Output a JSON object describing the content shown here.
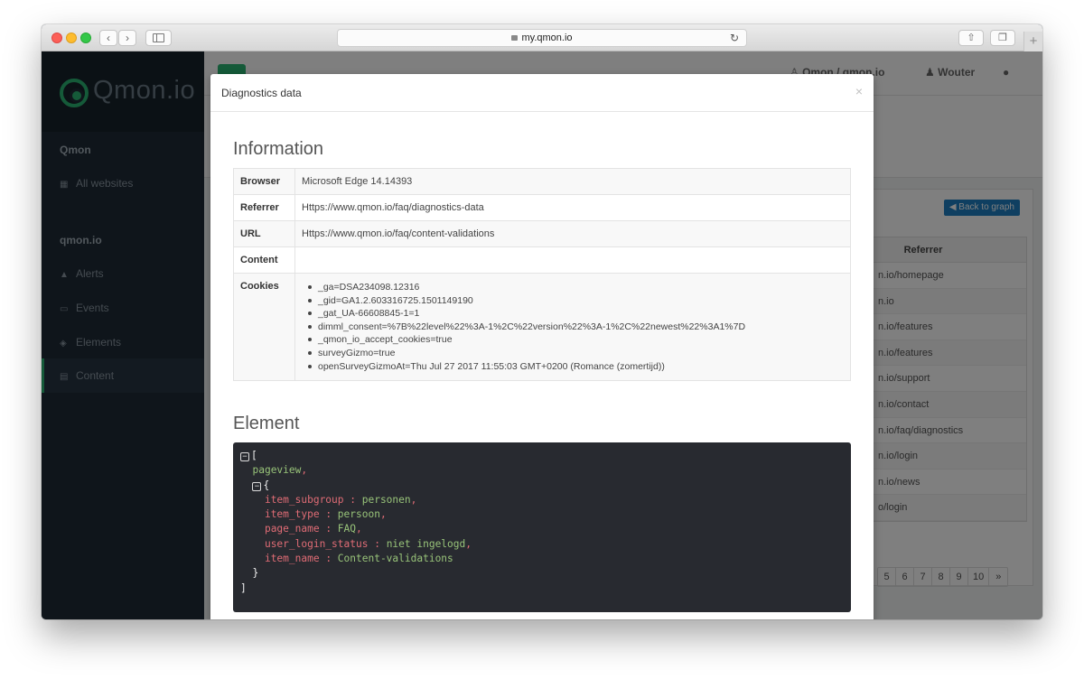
{
  "browser": {
    "url": "my.qmon.io"
  },
  "sidebar": {
    "logo_text": "Qmon.io",
    "section1": "Qmon",
    "item_all": "All websites",
    "section2": "qmon.io",
    "items": [
      {
        "label": "Alerts",
        "icon": "bell-icon"
      },
      {
        "label": "Events",
        "icon": "calendar-icon"
      },
      {
        "label": "Elements",
        "icon": "cube-icon"
      },
      {
        "label": "Content",
        "icon": "file-icon"
      }
    ]
  },
  "topbar": {
    "account": "Qmon / qmon.io",
    "user": "Wouter"
  },
  "panel": {
    "back_button": "Back to graph",
    "referrer_header": "Referrer",
    "referrer_rows": [
      "n.io/homepage",
      "n.io",
      "n.io/features",
      "n.io/features",
      "n.io/support",
      "n.io/contact",
      "n.io/faq/diagnostics",
      "n.io/login",
      "n.io/news",
      "o/login"
    ],
    "pager": [
      "5",
      "6",
      "7",
      "8",
      "9",
      "10",
      "»"
    ]
  },
  "modal": {
    "title": "Diagnostics data",
    "close": "×",
    "information_title": "Information",
    "info": {
      "browser_label": "Browser",
      "browser_value": "Microsoft Edge 14.14393",
      "referrer_label": "Referrer",
      "referrer_value": "Https://www.qmon.io/faq/diagnostics-data",
      "url_label": "URL",
      "url_value": "Https://www.qmon.io/faq/content-validations",
      "content_label": "Content",
      "content_value": "",
      "cookies_label": "Cookies",
      "cookies": [
        "_ga=DSA234098.12316",
        "_gid=GA1.2.603316725.1501149190",
        "_gat_UA-66608845-1=1",
        "dimml_consent=%7B%22level%22%3A-1%2C%22version%22%3A-1%2C%22newest%22%3A1%7D",
        "_qmon_io_accept_cookies=true",
        "surveyGizmo=true",
        "openSurveyGizmoAt=Thu Jul 27 2017 11:55:03 GMT+0200 (Romance (zomertijd))"
      ]
    },
    "element_title": "Element",
    "element": {
      "open_bracket": "[",
      "pageview": "pageview",
      "open_brace": "{",
      "fields": [
        {
          "key": "item_subgroup",
          "value": "personen"
        },
        {
          "key": "item_type",
          "value": "persoon"
        },
        {
          "key": "page_name",
          "value": "FAQ"
        },
        {
          "key": "user_login_status",
          "value": "niet ingelogd"
        },
        {
          "key": "item_name",
          "value": "Content-validations"
        }
      ],
      "close_brace": "}",
      "close_bracket": "]"
    }
  }
}
